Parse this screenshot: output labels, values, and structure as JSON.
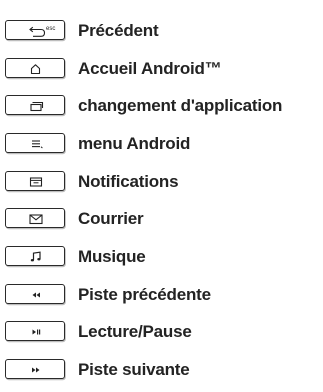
{
  "items": [
    {
      "label": "Précédent",
      "icon": "back-esc-icon",
      "key_text": "esc"
    },
    {
      "label": "Accueil Android™",
      "icon": "home-icon"
    },
    {
      "label": "changement d'application",
      "icon": "recent-apps-icon"
    },
    {
      "label": "menu Android",
      "icon": "menu-icon"
    },
    {
      "label": "Notifications",
      "icon": "notifications-icon"
    },
    {
      "label": "Courrier",
      "icon": "mail-icon"
    },
    {
      "label": "Musique",
      "icon": "music-icon"
    },
    {
      "label": "Piste précédente",
      "icon": "previous-track-icon"
    },
    {
      "label": "Lecture/Pause",
      "icon": "play-pause-icon"
    },
    {
      "label": "Piste suivante",
      "icon": "next-track-icon"
    }
  ]
}
